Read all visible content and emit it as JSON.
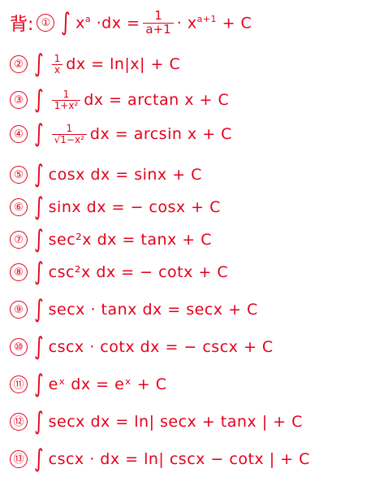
{
  "lead": "背:",
  "formulas": [
    {
      "num": "①",
      "pre": "x",
      "sup": "a",
      "mid": "·dx =",
      "fn": "1",
      "fd": "a+1",
      "post": "· x",
      "sup2": "a+1",
      "tail": "+ C"
    },
    {
      "num": "②",
      "fn": "1",
      "fd": "x",
      "post": "dx = ln|x| + C"
    },
    {
      "num": "③",
      "fn": "1",
      "fd": "1+x²",
      "post": "dx = arctan x + C"
    },
    {
      "num": "④",
      "fn": "1",
      "fd": "√1−x²",
      "post": "dx = arcsin x + C"
    },
    {
      "num": "⑤",
      "post": "cosx dx = sinx + C"
    },
    {
      "num": "⑥",
      "post": "sinx dx = − cosx + C"
    },
    {
      "num": "⑦",
      "post": "sec²x dx = tanx + C"
    },
    {
      "num": "⑧",
      "post": "csc²x dx = − cotx + C"
    },
    {
      "num": "⑨",
      "post": "secx · tanx dx = secx + C"
    },
    {
      "num": "⑩",
      "post": "cscx · cotx dx = − cscx + C"
    },
    {
      "num": "⑪",
      "post": "eˣ dx = eˣ + C"
    },
    {
      "num": "⑫",
      "post": "secx dx = ln| secx + tanx | + C"
    },
    {
      "num": "⑬",
      "post": "cscx · dx = ln| cscx − cotx | + C"
    }
  ]
}
